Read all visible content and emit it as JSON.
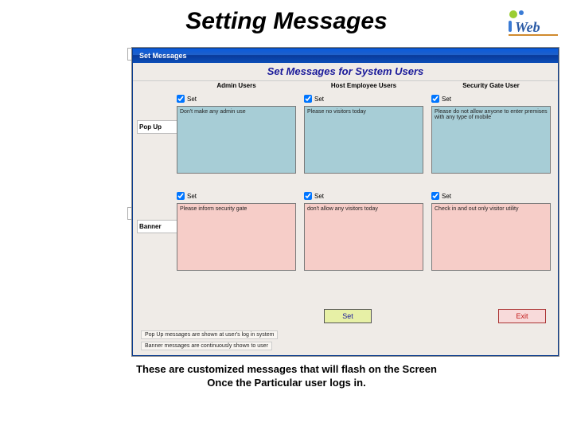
{
  "slide": {
    "title": "Setting Messages",
    "caption_line1": "These are customized messages that will flash on the Screen",
    "caption_line2": "Once the Particular user logs in."
  },
  "logo": {
    "name": "iWeb"
  },
  "window": {
    "titlebar": "Set Messages",
    "banner": "Set Messages for System Users"
  },
  "columns": {
    "admin": {
      "header": "Admin Users"
    },
    "host": {
      "header": "Host Employee Users"
    },
    "security": {
      "header": "Security Gate User"
    }
  },
  "rows": {
    "popup_label": "Pop Up",
    "banner_label": "Banner"
  },
  "cells": {
    "popup": {
      "admin": {
        "set_label": "Set",
        "checked": true,
        "text": "Don't make any admin use"
      },
      "host": {
        "set_label": "Set",
        "checked": true,
        "text": "Please no visitors today"
      },
      "security": {
        "set_label": "Set",
        "checked": true,
        "text": "Please do not allow anyone to enter premises with any type of mobile"
      }
    },
    "banner": {
      "admin": {
        "set_label": "Set",
        "checked": true,
        "text": "Please inform security gate"
      },
      "host": {
        "set_label": "Set",
        "checked": true,
        "text": "don't allow any visitors today"
      },
      "security": {
        "set_label": "Set",
        "checked": true,
        "text": "Check in and out only visitor utility"
      }
    }
  },
  "buttons": {
    "set": "Set",
    "exit": "Exit"
  },
  "footnotes": {
    "line1": "Pop Up messages are shown at user's log in system",
    "line2": "Banner messages are continuously shown to user"
  }
}
